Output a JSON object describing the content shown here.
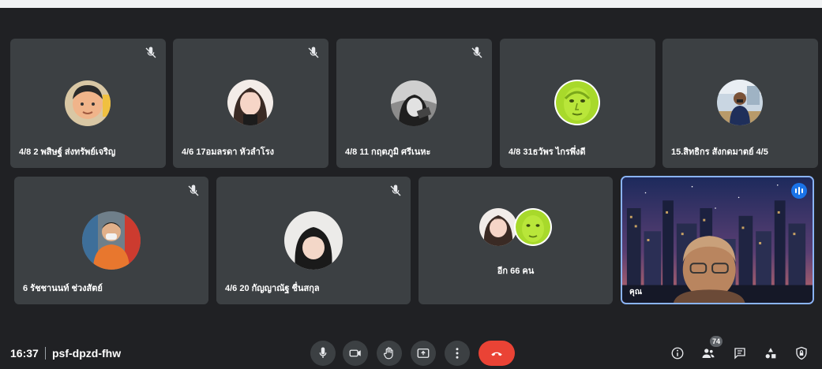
{
  "participants_row1": [
    {
      "name": "4/8 2 พสิษฐ์ ส่งทรัพย์เจริญ",
      "muted": true
    },
    {
      "name": "4/6 17อมลรดา หัวลำโรง",
      "muted": true
    },
    {
      "name": "4/8 11 กฤตภูมิ ศรีเนหะ",
      "muted": true
    },
    {
      "name": "4/8 31ธวัพร ไกรพึ่งดี",
      "muted": false
    },
    {
      "name": "15.สิทธิกร สังกดมาตย์ 4/5",
      "muted": false
    }
  ],
  "participants_row2": [
    {
      "name": "6 รัชชานนท์ ช่วงสัตย์",
      "muted": true
    },
    {
      "name": "4/6 20 กัญญาณัฐ ชื่นสกุล",
      "muted": true
    }
  ],
  "more": {
    "label": "อีก 66 คน"
  },
  "self": {
    "label": "คุณ"
  },
  "footer": {
    "time": "16:37",
    "separator": "|",
    "meeting_code": "psf-dpzd-fhw",
    "people_count": "74"
  },
  "colors": {
    "end_call": "#ea4335",
    "accent": "#1a73e8",
    "tile": "#3c4043",
    "background": "#202124"
  }
}
